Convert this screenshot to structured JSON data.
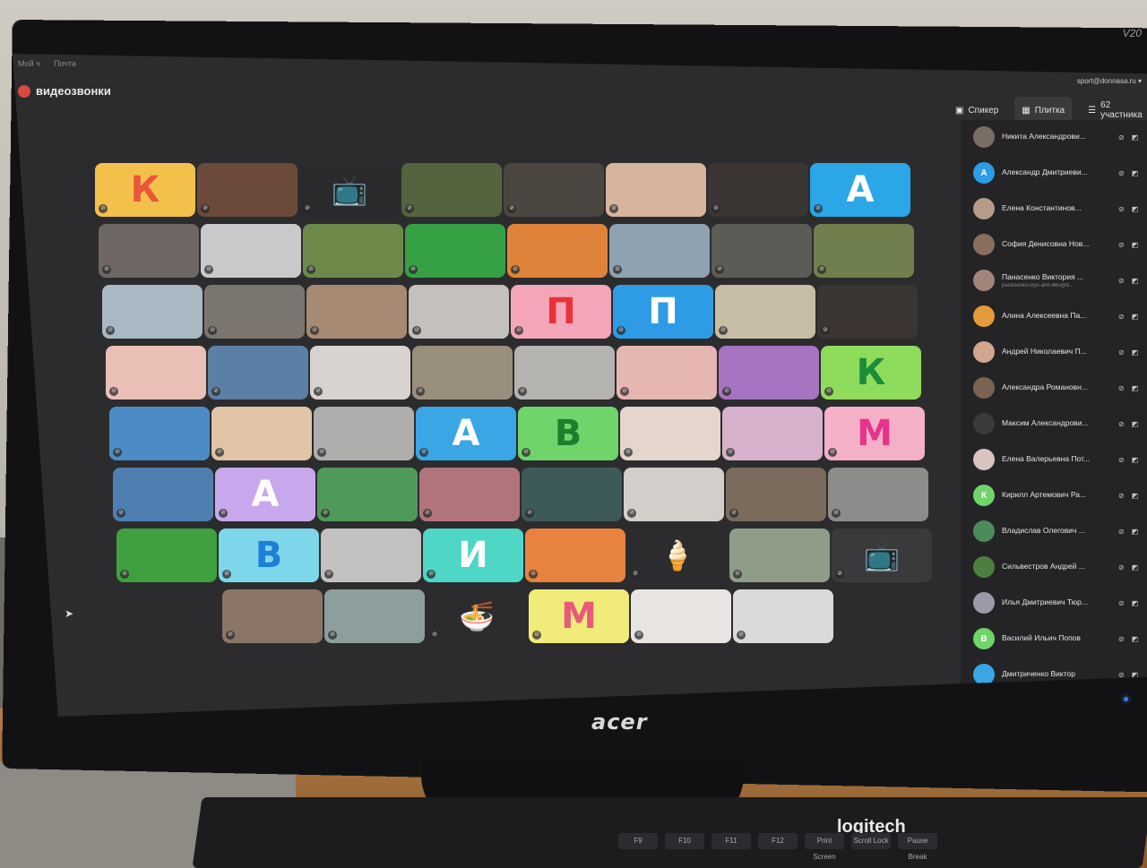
{
  "top_nav": [
    "Мой ч",
    "Почта"
  ],
  "app": {
    "title": "видеозвонки"
  },
  "account": {
    "email": "sport@donnasa.ru ▾"
  },
  "view_controls": [
    {
      "label": "Спикер",
      "icon": "speaker-icon"
    },
    {
      "label": "Плитка",
      "icon": "tile-grid-icon",
      "active": true
    },
    {
      "label": "62 участника",
      "icon": "participants-list-icon"
    }
  ],
  "monitor": {
    "brand": "acer",
    "model": "V20"
  },
  "keyboard": {
    "brand": "logitech",
    "keys": [
      "F9",
      "F10",
      "F11",
      "F12",
      "Print Screen",
      "Scroll Lock",
      "Pause Break"
    ]
  },
  "tiles": [
    {
      "type": "letter",
      "text": "К",
      "color": "#f4c04c",
      "text_color": "#e8573a"
    },
    {
      "type": "photo",
      "color": "#6b4a3c"
    },
    {
      "type": "tv",
      "color": "#2a2a2c"
    },
    {
      "type": "photo",
      "color": "#55633f"
    },
    {
      "type": "photo",
      "color": "#4b4640"
    },
    {
      "type": "photo",
      "color": "#d7b49d"
    },
    {
      "type": "photo",
      "color": "#3b3533"
    },
    {
      "type": "letter",
      "text": "А",
      "color": "#2ba6e6",
      "text_color": "#ffffff"
    },
    {
      "type": "photo",
      "color": "#6e6763"
    },
    {
      "type": "blank",
      "color": "#c9c9cc"
    },
    {
      "type": "photo",
      "color": "#6d8a4b"
    },
    {
      "type": "photo",
      "color": "#35a144"
    },
    {
      "type": "photo",
      "color": "#e0833a"
    },
    {
      "type": "photo",
      "color": "#8ea2b2"
    },
    {
      "type": "photo",
      "color": "#5d5b57"
    },
    {
      "type": "photo",
      "color": "#6f7f4d"
    },
    {
      "type": "photo",
      "color": "#a8b8c4"
    },
    {
      "type": "photo",
      "color": "#7b7570"
    },
    {
      "type": "photo",
      "color": "#a78a73"
    },
    {
      "type": "photo",
      "color": "#c3c0bd"
    },
    {
      "type": "letter",
      "text": "П",
      "color": "#f4a6b8",
      "text_color": "#e8333a"
    },
    {
      "type": "letter",
      "text": "П",
      "color": "#2e9be6",
      "text_color": "#ffffff"
    },
    {
      "type": "photo",
      "color": "#c7bca6"
    },
    {
      "type": "photo",
      "color": "#3b3534"
    },
    {
      "type": "photo",
      "color": "#e9bfb6"
    },
    {
      "type": "photo",
      "color": "#5c7fa6"
    },
    {
      "type": "photo",
      "color": "#d8d3d0"
    },
    {
      "type": "photo",
      "color": "#9a8e7d"
    },
    {
      "type": "photo",
      "color": "#b5b3b0"
    },
    {
      "type": "photo",
      "color": "#e6b6b1"
    },
    {
      "type": "photo",
      "color": "#a774c2"
    },
    {
      "type": "letter",
      "text": "К",
      "color": "#8fdc5c",
      "text_color": "#1d8c3a"
    },
    {
      "type": "photo",
      "color": "#4d8bc6"
    },
    {
      "type": "photo",
      "color": "#dfc4a6"
    },
    {
      "type": "photo",
      "color": "#b0aeac"
    },
    {
      "type": "letter",
      "text": "А",
      "color": "#3aa6e6",
      "text_color": "#ffffff"
    },
    {
      "type": "letter",
      "text": "В",
      "color": "#6fd46a",
      "text_color": "#1c7f2e"
    },
    {
      "type": "photo",
      "color": "#e4d6cc"
    },
    {
      "type": "photo",
      "color": "#d6b2cc"
    },
    {
      "type": "letter",
      "text": "М",
      "color": "#f4b0c6",
      "text_color": "#e8338a"
    },
    {
      "type": "photo",
      "color": "#4e7fb0"
    },
    {
      "type": "letter",
      "text": "А",
      "color": "#c8a8ec",
      "text_color": "#ffffff"
    },
    {
      "type": "photo",
      "color": "#4f9a5a"
    },
    {
      "type": "photo",
      "color": "#b2747c"
    },
    {
      "type": "photo",
      "color": "#3e5a58"
    },
    {
      "type": "photo",
      "color": "#d2cfcb"
    },
    {
      "type": "photo",
      "color": "#7a6b5c"
    },
    {
      "type": "photo",
      "color": "#8e8c8a"
    },
    {
      "type": "photo",
      "color": "#3ea03e"
    },
    {
      "type": "letter",
      "text": "В",
      "color": "#7ed6ea",
      "text_color": "#1d7fd6"
    },
    {
      "type": "photo",
      "color": "#c3c1bf"
    },
    {
      "type": "letter",
      "text": "И",
      "color": "#4ed6c6",
      "text_color": "#ffffff"
    },
    {
      "type": "photo",
      "color": "#e7833e"
    },
    {
      "type": "icecream",
      "color": "#2c2c2e"
    },
    {
      "type": "photo",
      "color": "#8e9c88"
    },
    {
      "type": "tv",
      "color": "#3a3a3c"
    },
    {
      "type": "photo",
      "color": "#8a7566"
    },
    {
      "type": "photo",
      "color": "#8e9e9c"
    },
    {
      "type": "noodles",
      "color": "#2c2c2e"
    },
    {
      "type": "letter",
      "text": "М",
      "color": "#f1ec7a",
      "text_color": "#e85a7a"
    },
    {
      "type": "photo",
      "color": "#e8e4e2"
    },
    {
      "type": "photo",
      "color": "#d8dadc"
    }
  ],
  "participants": [
    {
      "name": "Никита Александрови...",
      "email": "",
      "avatar_color": "#7a6d64",
      "initial": ""
    },
    {
      "name": "Александр Дмитриеви...",
      "email": "",
      "avatar_color": "#2e9be6",
      "initial": "А"
    },
    {
      "name": "Елена Константинов...",
      "email": "",
      "avatar_color": "#b79b8a",
      "initial": ""
    },
    {
      "name": "София Денисовна Нов...",
      "email": "",
      "avatar_color": "#8a6e5f",
      "initial": ""
    },
    {
      "name": "Панасенко Виктория ...",
      "email": "panasenko.viyu-ann-46v@d...",
      "avatar_color": "#a1857a",
      "initial": ""
    },
    {
      "name": "Алина Алексеевна Па...",
      "email": "",
      "avatar_color": "#e59a3a",
      "initial": ""
    },
    {
      "name": "Андрей Николаевич П...",
      "email": "",
      "avatar_color": "#d2a58f",
      "initial": ""
    },
    {
      "name": "Александра Романовн...",
      "email": "",
      "avatar_color": "#7c6251",
      "initial": ""
    },
    {
      "name": "Максим Александрови...",
      "email": "",
      "avatar_color": "#3a3a3c",
      "initial": ""
    },
    {
      "name": "Елена Валерьевна Пот...",
      "email": "",
      "avatar_color": "#d9c3c0",
      "initial": ""
    },
    {
      "name": "Кирилл Артемович Ра...",
      "email": "",
      "avatar_color": "#6fd46a",
      "initial": "К"
    },
    {
      "name": "Владислав Олегович ...",
      "email": "",
      "avatar_color": "#4c8c5a",
      "initial": ""
    },
    {
      "name": "Сильвестров Андрей ...",
      "email": "",
      "avatar_color": "#4c8040",
      "initial": ""
    },
    {
      "name": "Илья Дмитриевич Тюр...",
      "email": "",
      "avatar_color": "#9a9aa8",
      "initial": ""
    },
    {
      "name": "Василий Ильич Попов",
      "email": "",
      "avatar_color": "#6fd46a",
      "initial": "В"
    },
    {
      "name": "Дмитриченко Виктор",
      "email": "",
      "avatar_color": "#3aa6e6",
      "initial": ""
    }
  ]
}
